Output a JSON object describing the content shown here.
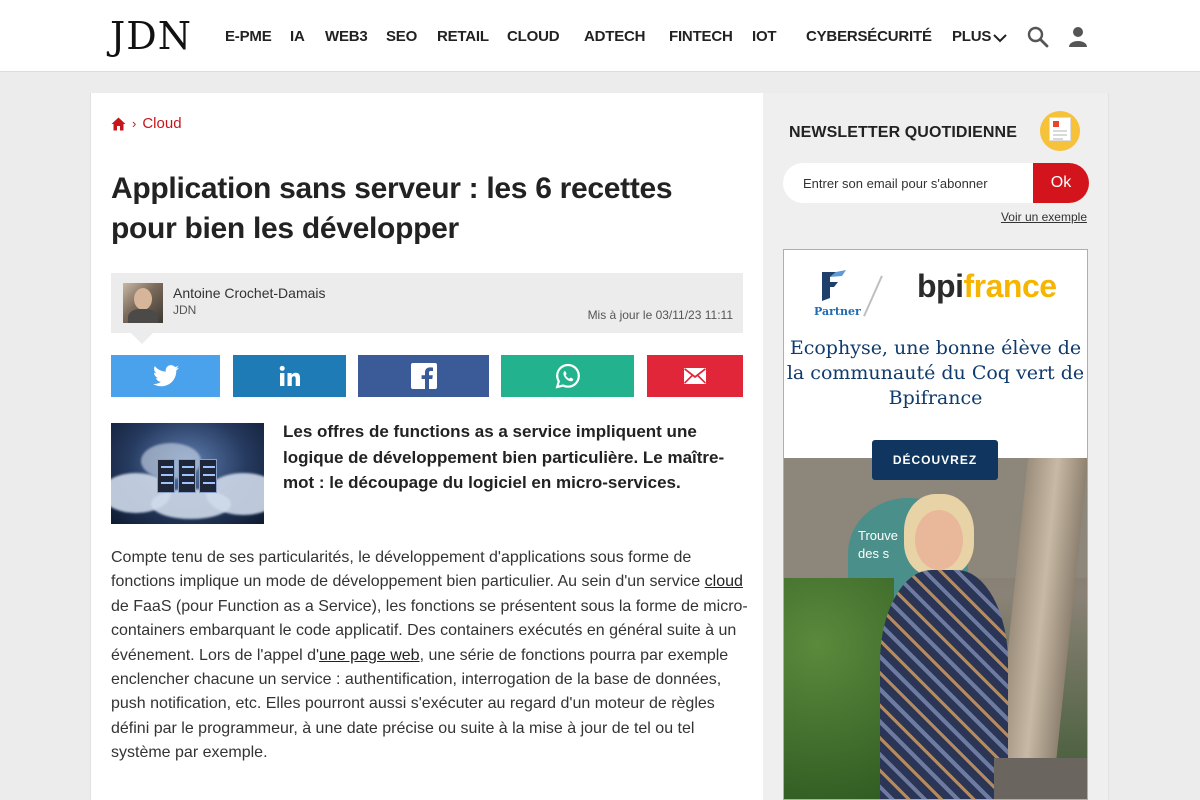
{
  "header": {
    "logo": "JDN",
    "nav": [
      {
        "label": "E-PME",
        "name": "nav-e-pme"
      },
      {
        "label": "IA",
        "name": "nav-ia"
      },
      {
        "label": "WEB3",
        "name": "nav-web3"
      },
      {
        "label": "SEO",
        "name": "nav-seo"
      },
      {
        "label": "RETAIL",
        "name": "nav-retail"
      },
      {
        "label": "CLOUD",
        "name": "nav-cloud"
      },
      {
        "label": "ADTECH",
        "name": "nav-adtech"
      },
      {
        "label": "FINTECH",
        "name": "nav-fintech"
      },
      {
        "label": "IOT",
        "name": "nav-iot"
      },
      {
        "label": "CYBERSÉCURITÉ",
        "name": "nav-cybersecurite"
      },
      {
        "label": "PLUS",
        "name": "nav-plus"
      }
    ],
    "icons": [
      "search-icon",
      "user-icon"
    ]
  },
  "breadcrumb": {
    "home_icon": "home-icon",
    "section": "Cloud"
  },
  "article": {
    "title": "Application sans serveur : les 6 recettes pour bien les développer",
    "author": {
      "name": "Antoine Crochet-Damais",
      "org": "JDN"
    },
    "updated": "Mis à jour le 03/11/23 11:11",
    "share": [
      {
        "name": "share-twitter-button",
        "icon": "twitter-icon",
        "color": "#4aa1ec"
      },
      {
        "name": "share-linkedin-button",
        "icon": "linkedin-icon",
        "color": "#1f7bb5"
      },
      {
        "name": "share-facebook-button",
        "icon": "facebook-icon",
        "color": "#3a5a98"
      },
      {
        "name": "share-whatsapp-button",
        "icon": "whatsapp-icon",
        "color": "#22b38e"
      },
      {
        "name": "share-email-button",
        "icon": "email-icon",
        "color": "#e2263a"
      }
    ],
    "lead": "Les offres de functions as a service impliquent une logique de développement bien particulière. Le maître-mot : le découpage du logiciel en micro-services.",
    "body": {
      "p1": "Compte tenu de ses particularités, le développement d'applications sous forme de fonctions implique un mode de développement bien particulier. Au sein d'un service ",
      "link1": "cloud",
      "p2": " de FaaS (pour Function as a Service), les fonctions se présentent sous la forme de micro-containers embarquant le code applicatif. Des containers exécutés en général suite à un événement. Lors de l'appel d'",
      "link2": "une page web",
      "p3": ", une série de fonctions pourra par exemple enclencher chacune un service : authentification, interrogation de la base de données, push notification, etc. Elles pourront aussi s'exécuter au regard d'un moteur de règles défini par le programmeur, à une date précise ou suite à la mise à jour de tel ou tel système par exemple."
    }
  },
  "sidebar": {
    "newsletter": {
      "title": "NEWSLETTER QUOTIDIENNE",
      "placeholder": "Entrer son email pour s'abonner",
      "button": "Ok",
      "example": "Voir un exemple"
    },
    "ad": {
      "partner": "Partner",
      "bpi_part1": "bpi",
      "bpi_part2": "france",
      "headline": "Ecophyse, une bonne élève de la communauté du Coq vert de Bpifrance",
      "cta": "DÉCOUVREZ",
      "photo_sign_line1": "Trouve",
      "photo_sign_line2": "des s"
    }
  },
  "colors": {
    "accent_red": "#c4161c",
    "ok_button": "#d4141c",
    "ad_navy": "#10365f",
    "bpi_yellow": "#f5b500"
  }
}
